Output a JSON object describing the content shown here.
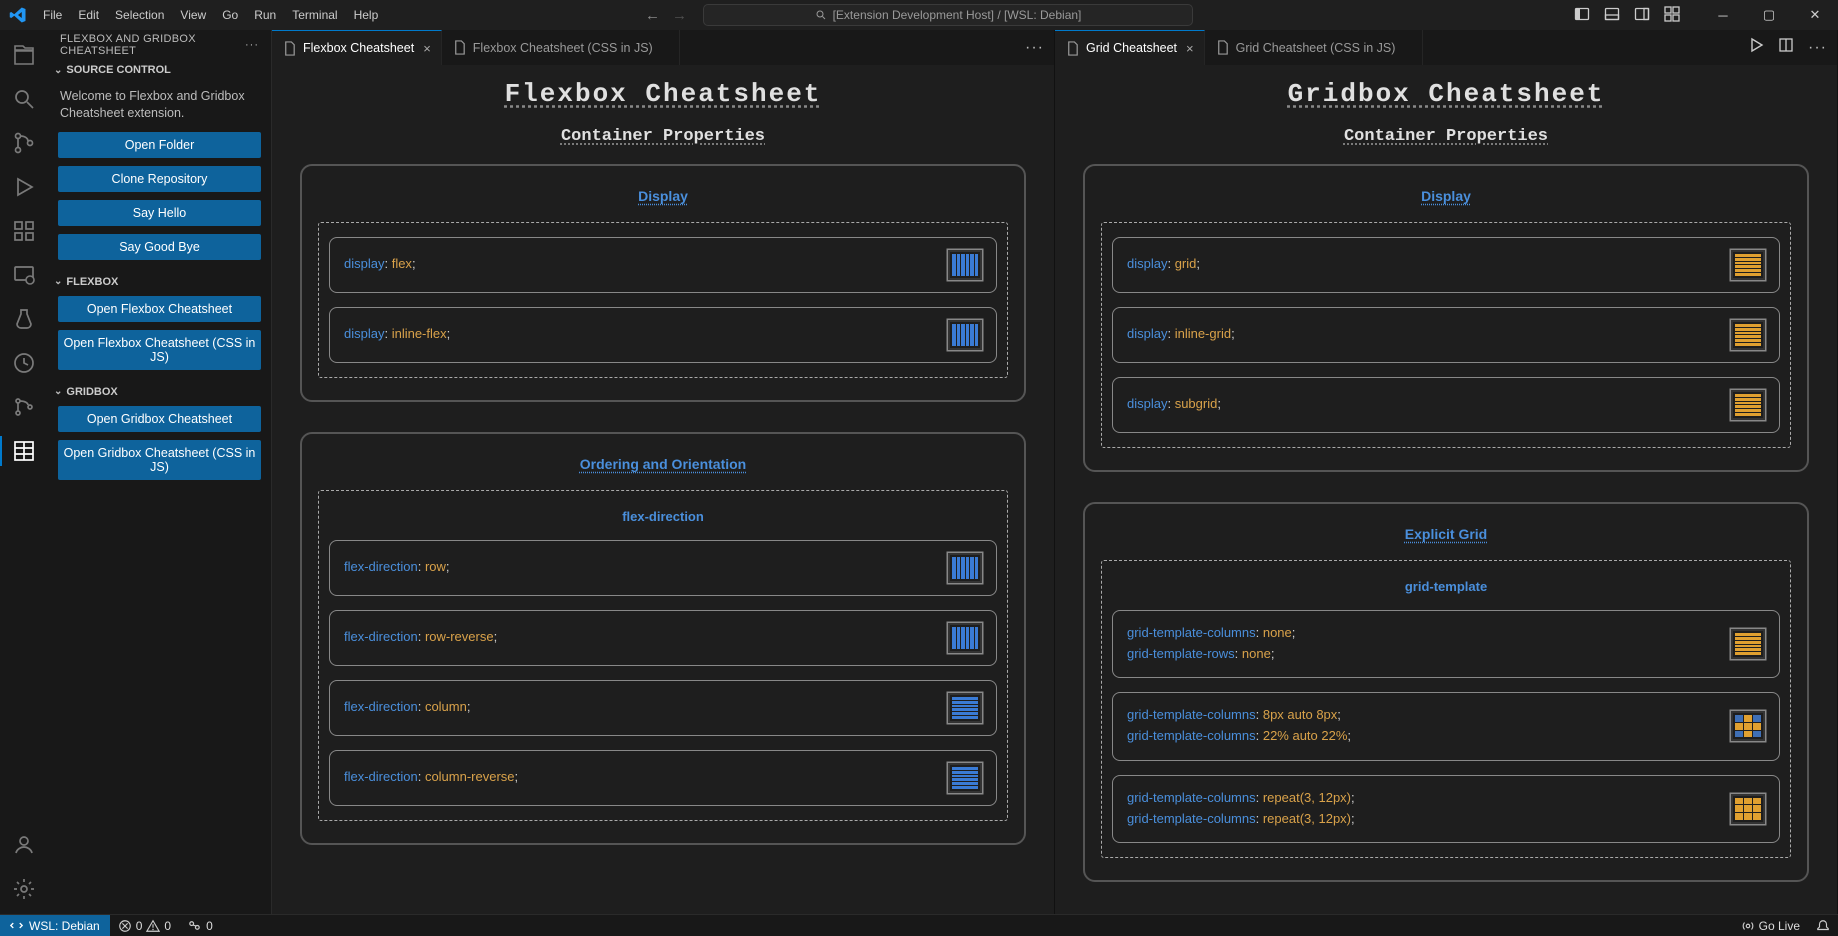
{
  "menubar": [
    "File",
    "Edit",
    "Selection",
    "View",
    "Go",
    "Run",
    "Terminal",
    "Help"
  ],
  "search_caption": "[Extension Development Host] / [WSL: Debian]",
  "sidebar": {
    "title": "FLEXBOX AND GRIDBOX CHEATSHEET",
    "sections": [
      {
        "hdr": "SOURCE CONTROL",
        "welcome": "Welcome to Flexbox and Gridbox Cheatsheet extension.",
        "buttons": [
          "Open Folder",
          "Clone Repository",
          "Say Hello",
          "Say Good Bye"
        ]
      },
      {
        "hdr": "FLEXBOX",
        "buttons": [
          "Open Flexbox Cheatsheet",
          "Open Flexbox Cheatsheet (CSS in JS)"
        ]
      },
      {
        "hdr": "GRIDBOX",
        "buttons": [
          "Open Gridbox Cheatsheet",
          "Open Gridbox Cheatsheet (CSS in JS)"
        ]
      }
    ]
  },
  "tabgroups": [
    {
      "tabs": [
        {
          "label": "Flexbox Cheatsheet",
          "active": true
        },
        {
          "label": "Flexbox Cheatsheet (CSS in JS)",
          "active": false
        }
      ],
      "actions": true
    },
    {
      "tabs": [
        {
          "label": "Grid Cheatsheet",
          "active": true
        },
        {
          "label": "Grid Cheatsheet (CSS in JS)",
          "active": false
        }
      ],
      "actions": true,
      "playIcons": true
    }
  ],
  "panes": [
    {
      "title": "Flexbox Cheatsheet",
      "sectionTitle": "Container Properties",
      "boxes": [
        {
          "groupTitle": "Display",
          "rows": [
            {
              "lines": [
                {
                  "prop": "display",
                  "val": "flex"
                }
              ],
              "swatch": {
                "color": "blue",
                "dir": "v"
              }
            },
            {
              "lines": [
                {
                  "prop": "display",
                  "val": "inline-flex"
                }
              ],
              "swatch": {
                "color": "blue",
                "dir": "v"
              }
            }
          ]
        },
        {
          "groupTitle": "Ordering and Orientation",
          "sub": "flex-direction",
          "rows": [
            {
              "lines": [
                {
                  "prop": "flex-direction",
                  "val": "row"
                }
              ],
              "swatch": {
                "color": "blue",
                "dir": "v"
              }
            },
            {
              "lines": [
                {
                  "prop": "flex-direction",
                  "val": "row-reverse"
                }
              ],
              "swatch": {
                "color": "blue",
                "dir": "v"
              }
            },
            {
              "lines": [
                {
                  "prop": "flex-direction",
                  "val": "column"
                }
              ],
              "swatch": {
                "color": "blue",
                "dir": "h"
              }
            },
            {
              "lines": [
                {
                  "prop": "flex-direction",
                  "val": "column-reverse"
                }
              ],
              "swatch": {
                "color": "blue",
                "dir": "h"
              }
            }
          ]
        }
      ]
    },
    {
      "title": "Gridbox Cheatsheet",
      "sectionTitle": "Container Properties",
      "boxes": [
        {
          "groupTitle": "Display",
          "rows": [
            {
              "lines": [
                {
                  "prop": "display",
                  "val": "grid"
                }
              ],
              "swatch": {
                "color": "orange",
                "dir": "h"
              }
            },
            {
              "lines": [
                {
                  "prop": "display",
                  "val": "inline-grid"
                }
              ],
              "swatch": {
                "color": "orange",
                "dir": "h"
              }
            },
            {
              "lines": [
                {
                  "prop": "display",
                  "val": "subgrid"
                }
              ],
              "swatch": {
                "color": "orange",
                "dir": "h"
              }
            }
          ]
        },
        {
          "groupTitle": "Explicit Grid",
          "sub": "grid-template",
          "rows": [
            {
              "lines": [
                {
                  "prop": "grid-template-columns",
                  "val": "none"
                },
                {
                  "prop": "grid-template-rows",
                  "val": "none"
                }
              ],
              "swatch": {
                "color": "orange",
                "dir": "h"
              }
            },
            {
              "lines": [
                {
                  "prop": "grid-template-columns",
                  "val": "8px auto 8px"
                },
                {
                  "prop": "grid-template-columns",
                  "val": "22% auto 22%"
                }
              ],
              "swatch": {
                "grid": "mix"
              }
            },
            {
              "lines": [
                {
                  "prop": "grid-template-columns",
                  "val": "repeat(3, 12px)"
                },
                {
                  "prop": "grid-template-columns",
                  "val": "repeat(3, 12px)"
                }
              ],
              "swatch": {
                "grid": "plain"
              }
            }
          ]
        }
      ]
    }
  ],
  "statusbar": {
    "remote": "WSL: Debian",
    "errors": "0",
    "warnings": "0",
    "ports": "0",
    "golive": "Go Live"
  },
  "chart_data": null
}
